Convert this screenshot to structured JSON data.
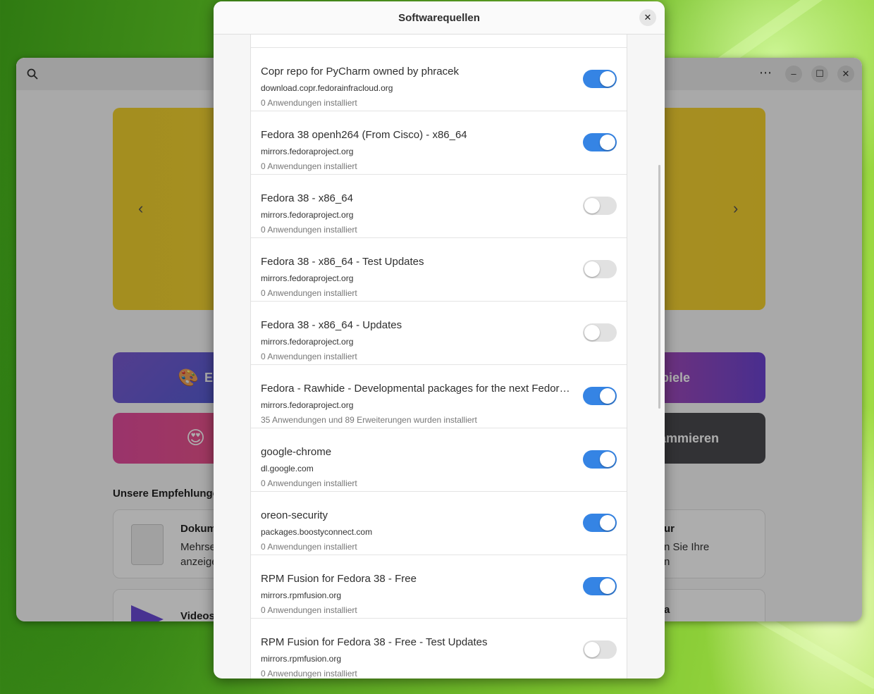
{
  "dialog": {
    "title": "Softwarequellen",
    "close_icon": "close-icon"
  },
  "background_app": {
    "window_controls": [
      "minimize-icon",
      "maximize-icon",
      "close-icon"
    ],
    "menu_icon": "ellipsis-icon",
    "search_icon": "search-icon",
    "category_tiles": [
      {
        "label": "E",
        "color": "#5a63d6"
      },
      {
        "label": "piele",
        "color": "#8b46c4"
      },
      {
        "label": "",
        "color": "#e04a9a"
      },
      {
        "label": "ammieren",
        "color": "#4b4b4f"
      }
    ],
    "recommendations_title": "Unsere Empfehlunge",
    "rec_cards": [
      {
        "title": "Dokum",
        "desc_line1": "Mehrse",
        "desc_line2": "anzeige"
      },
      {
        "title": "ur",
        "desc_line1": "n Sie Ihre",
        "desc_line2": "n"
      },
      {
        "title": "Videos",
        "desc_line1": "",
        "desc_line2": ""
      },
      {
        "title": "a",
        "desc_line1": "",
        "desc_line2": ""
      }
    ]
  },
  "repositories": [
    {
      "name": "",
      "host": "",
      "count": "",
      "enabled": false,
      "partial": true
    },
    {
      "name": "Copr repo for PyCharm owned by phracek",
      "host": "download.copr.fedorainfracloud.org",
      "count": "0 Anwendungen installiert",
      "enabled": true
    },
    {
      "name": "Fedora 38 openh264 (From Cisco) - x86_64",
      "host": "mirrors.fedoraproject.org",
      "count": "0 Anwendungen installiert",
      "enabled": true
    },
    {
      "name": "Fedora 38 - x86_64",
      "host": "mirrors.fedoraproject.org",
      "count": "0 Anwendungen installiert",
      "enabled": false
    },
    {
      "name": "Fedora 38 - x86_64 - Test Updates",
      "host": "mirrors.fedoraproject.org",
      "count": "0 Anwendungen installiert",
      "enabled": false
    },
    {
      "name": "Fedora 38 - x86_64 - Updates",
      "host": "mirrors.fedoraproject.org",
      "count": "0 Anwendungen installiert",
      "enabled": false
    },
    {
      "name": "Fedora - Rawhide - Developmental packages for the next Fedora r…",
      "host": "mirrors.fedoraproject.org",
      "count": "35 Anwendungen und 89 Erweiterungen wurden installiert",
      "enabled": true
    },
    {
      "name": "google-chrome",
      "host": "dl.google.com",
      "count": "0 Anwendungen installiert",
      "enabled": true
    },
    {
      "name": "oreon-security",
      "host": "packages.boostyconnect.com",
      "count": "0 Anwendungen installiert",
      "enabled": true
    },
    {
      "name": "RPM Fusion for Fedora 38 - Free",
      "host": "mirrors.rpmfusion.org",
      "count": "0 Anwendungen installiert",
      "enabled": true
    },
    {
      "name": "RPM Fusion for Fedora 38 - Free - Test Updates",
      "host": "mirrors.rpmfusion.org",
      "count": "0 Anwendungen installiert",
      "enabled": false
    }
  ],
  "colors": {
    "switch_on": "#3584e4",
    "switch_off": "#e1e1e1",
    "banner": "#f2d22e"
  }
}
